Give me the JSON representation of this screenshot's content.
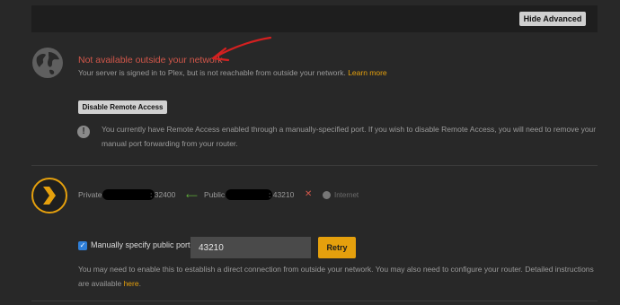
{
  "header": {
    "hide_advanced_label": "Hide Advanced"
  },
  "status": {
    "title": "Not available outside your network",
    "description": "Your server is signed in to Plex, but is not reachable from outside your network.",
    "learn_more": "Learn more",
    "status_color": "#d2574a"
  },
  "remote_access": {
    "disable_label": "Disable Remote Access",
    "info_text": "You currently have Remote Access enabled through a manually-specified port. If you wish to disable Remote Access, you will need to remove your manual port forwarding from your router."
  },
  "connection": {
    "private_label": "Private",
    "private_port": ": 32400",
    "public_label": "Public",
    "public_port": ": 43210",
    "internet_label": "Internet"
  },
  "port_settings": {
    "checkbox_label": "Manually specify public port",
    "port_value": "43210",
    "retry_label": "Retry",
    "help_text": "You may need to enable this to establish a direct connection from outside your network. You may also need to configure your router. Detailed instructions are available",
    "help_link": "here",
    "accent_color": "#e5a00d"
  },
  "icons": [
    "globe-icon",
    "info-icon",
    "plex-logo-icon",
    "arrow-left-icon",
    "close-icon",
    "internet-icon",
    "check-icon",
    "annotation-arrow"
  ]
}
